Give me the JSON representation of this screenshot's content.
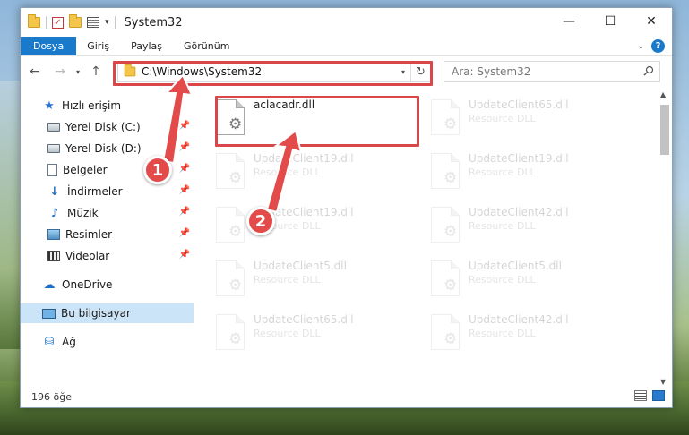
{
  "window": {
    "title": "System32"
  },
  "ribbon": {
    "tabs": [
      "Dosya",
      "Giriş",
      "Paylaş",
      "Görünüm"
    ],
    "active_tab": "Dosya"
  },
  "address": {
    "path": "C:\\Windows\\System32"
  },
  "search": {
    "placeholder": "Ara: System32"
  },
  "sidebar": {
    "items": [
      {
        "label": "Hızlı erişim",
        "icon": "star-icon"
      },
      {
        "label": "Yerel Disk (C:)",
        "icon": "drive-icon",
        "pinned": true
      },
      {
        "label": "Yerel Disk (D:)",
        "icon": "drive-icon",
        "pinned": true
      },
      {
        "label": "Belgeler",
        "icon": "document-icon",
        "pinned": true
      },
      {
        "label": "İndirmeler",
        "icon": "download-icon",
        "pinned": true
      },
      {
        "label": "Müzik",
        "icon": "music-icon",
        "pinned": true
      },
      {
        "label": "Resimler",
        "icon": "pictures-icon",
        "pinned": true
      },
      {
        "label": "Videolar",
        "icon": "videos-icon",
        "pinned": true
      },
      {
        "label": "OneDrive",
        "icon": "cloud-icon"
      },
      {
        "label": "Bu bilgisayar",
        "icon": "computer-icon",
        "selected": true
      },
      {
        "label": "Ağ",
        "icon": "network-icon"
      }
    ]
  },
  "files": [
    {
      "name": "aclacadr.dll",
      "desc": "",
      "ghost": false
    },
    {
      "name": "UpdateClient65.dll",
      "desc": "Resource DLL",
      "ghost": true
    },
    {
      "name": "UpdateClient19.dll",
      "desc": "Resource DLL",
      "ghost": true
    },
    {
      "name": "UpdateClient19.dll",
      "desc": "Resource DLL",
      "ghost": true
    },
    {
      "name": "UpdateClient19.dll",
      "desc": "Resource DLL",
      "ghost": true
    },
    {
      "name": "UpdateClient42.dll",
      "desc": "Resource DLL",
      "ghost": true
    },
    {
      "name": "UpdateClient5.dll",
      "desc": "Resource DLL",
      "ghost": true
    },
    {
      "name": "UpdateClient5.dll",
      "desc": "Resource DLL",
      "ghost": true
    },
    {
      "name": "UpdateClient65.dll",
      "desc": "Resource DLL",
      "ghost": true
    },
    {
      "name": "UpdateClient42.dll",
      "desc": "Resource DLL",
      "ghost": true
    }
  ],
  "status": {
    "item_count": "196 öğe"
  },
  "annotations": {
    "markers": [
      "1",
      "2"
    ],
    "color": "#e34b4b"
  }
}
